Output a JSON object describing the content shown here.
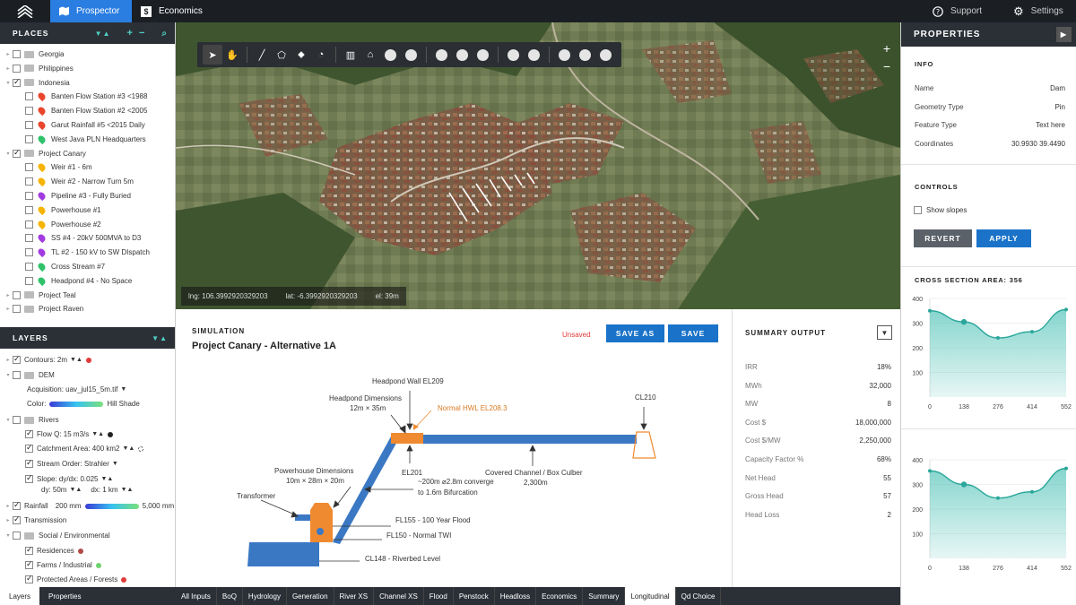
{
  "topbar": {
    "tabs": [
      {
        "label": "Prospector",
        "icon": "map-icon"
      },
      {
        "label": "Economics",
        "icon": "dollar-icon"
      }
    ],
    "support": "Support",
    "settings": "Settings"
  },
  "places": {
    "title": "PLACES",
    "items": [
      {
        "label": "Georgia",
        "kind": "folder",
        "checked": false
      },
      {
        "label": "Philippines",
        "kind": "folder",
        "checked": false
      },
      {
        "label": "Indonesia",
        "kind": "folder",
        "checked": true,
        "expanded": true
      },
      {
        "label": "Banten Flow Station #3 <1988",
        "kind": "pin",
        "color": "#e8452c"
      },
      {
        "label": "Banten Flow Station #2 <2005",
        "kind": "pin",
        "color": "#e8452c"
      },
      {
        "label": "Garut Rainfall #5 <2015 Daily",
        "kind": "pin",
        "color": "#e8452c"
      },
      {
        "label": "West Java PLN Headquarters",
        "kind": "pin",
        "color": "#2fc26b"
      },
      {
        "label": "Project Canary",
        "kind": "folder",
        "checked": true,
        "expanded": true
      },
      {
        "label": "Weir #1 - 6m",
        "kind": "pin",
        "color": "#f5b400"
      },
      {
        "label": "Weir #2 - Narrow Turn 5m",
        "kind": "pin",
        "color": "#f5b400"
      },
      {
        "label": "Pipeline #3 - Fully Buried",
        "kind": "pin",
        "color": "#a23be0"
      },
      {
        "label": "Powerhouse #1",
        "kind": "pin",
        "color": "#f5b400"
      },
      {
        "label": "Powerhouse #2",
        "kind": "pin",
        "color": "#f5b400"
      },
      {
        "label": "SS #4 - 20kV 500MVA to D3",
        "kind": "pin",
        "color": "#a23be0"
      },
      {
        "label": "TL #2 - 150 kV to SW DIspatch",
        "kind": "pin",
        "color": "#a23be0"
      },
      {
        "label": "Cross Stream #7",
        "kind": "pin",
        "color": "#2fc26b"
      },
      {
        "label": "Headpond #4 - No Space",
        "kind": "pin",
        "color": "#2fc26b"
      },
      {
        "label": "Project Teal",
        "kind": "folder",
        "checked": false
      },
      {
        "label": "Project Raven",
        "kind": "folder",
        "checked": false
      }
    ]
  },
  "layers": {
    "title": "LAYERS",
    "contours": "Contours: 2m",
    "dem": "DEM",
    "acquisition": "Acquisition: uav_jul15_5m.tif",
    "color_label": "Color:",
    "color_value": "Hill Shade",
    "rivers": "Rivers",
    "flow": "Flow Q: 15 m3/s",
    "catchment": "Catchment Area: 400 km2",
    "stream_order": "Stream Order: Strahler",
    "slope": "Slope: dy/dx: 0.025",
    "dy": "dy: 50m",
    "dx": "dx: 1 km",
    "rainfall": "Rainfall",
    "rain_min": "200 mm",
    "rain_max": "5,000 mm",
    "transmission": "Transmission",
    "social": "Social / Environmental",
    "residences": "Residences",
    "farms": "Farms / Industrial",
    "protected": "Protected Areas / Forests"
  },
  "left_tabs": [
    "Layers",
    "Properties"
  ],
  "map": {
    "lng": "lng: 106.3992920329203",
    "lat": "lat: -6.3992920329203",
    "el": "el: 39m",
    "zoom_in": "+",
    "zoom_out": "−"
  },
  "simulation": {
    "section": "SIMULATION",
    "title": "Project Canary - Alternative 1A",
    "status": "Unsaved",
    "save_as": "SAVE AS",
    "save": "SAVE",
    "labels": {
      "headpond_wall": "Headpond Wall EL209",
      "headpond_dims_1": "Headpond Dimensions",
      "headpond_dims_2": "12m × 35m",
      "normal_hwl": "Normal HWL EL208.3",
      "cl210": "CL210",
      "el201": "EL201",
      "converge_1": "~200m ⌀2.8m converge",
      "converge_2": "to 1.6m Bifurcation",
      "channel_1": "Covered Channel / Box Culber",
      "channel_2": "2,300m",
      "ph_dims_1": "Powerhouse Dimensions",
      "ph_dims_2": "10m × 28m × 20m",
      "transformer": "Transformer",
      "fl155": "FL155 - 100 Year Flood",
      "fl150": "FL150 - Normal TWI",
      "cl148": "CL148 - Riverbed Level"
    }
  },
  "summary": {
    "title": "SUMMARY OUTPUT",
    "rows": [
      {
        "k": "IRR",
        "v": "18%"
      },
      {
        "k": "MWh",
        "v": "32,000"
      },
      {
        "k": "MW",
        "v": "8"
      },
      {
        "k": "Cost $",
        "v": "18,000,000"
      },
      {
        "k": "Cost $/MW",
        "v": "2,250,000"
      },
      {
        "k": "Capacity Factor %",
        "v": "68%"
      },
      {
        "k": "Net Head",
        "v": "55"
      },
      {
        "k": "Gross Head",
        "v": "57"
      },
      {
        "k": "Head Loss",
        "v": "2"
      }
    ]
  },
  "bottom_tabs": [
    "All Inputs",
    "BoQ",
    "Hydrology",
    "Generation",
    "River XS",
    "Channel XS",
    "Flood",
    "Penstock",
    "Headloss",
    "Economics",
    "Summary",
    "Longitudinal",
    "Qd Choice"
  ],
  "properties": {
    "title": "PROPERTIES",
    "info_title": "INFO",
    "info": [
      {
        "k": "Name",
        "v": "Dam"
      },
      {
        "k": "Geometry Type",
        "v": "Pin"
      },
      {
        "k": "Feature Type",
        "v": "Text here"
      },
      {
        "k": "Coordinates",
        "v": "30.9930 39.4490"
      }
    ],
    "controls_title": "CONTROLS",
    "show_slopes": "Show slopes",
    "revert": "REVERT",
    "apply": "APPLY",
    "cross_section_title": "CROSS SECTION AREA: 356"
  },
  "colors": {
    "accent": "#2a7de1",
    "teal": "#2aa79b",
    "dark": "#2b3037"
  },
  "chart_data": [
    {
      "type": "area",
      "title": "CROSS SECTION AREA: 356",
      "x": [
        0,
        138,
        276,
        414,
        552
      ],
      "values": [
        350,
        305,
        240,
        265,
        355
      ],
      "xticks": [
        "0",
        "138",
        "276",
        "414",
        "552"
      ],
      "yticks": [
        "100",
        "200",
        "300",
        "400"
      ],
      "ylim": [
        0,
        400
      ]
    },
    {
      "type": "area",
      "x": [
        0,
        138,
        276,
        414,
        552
      ],
      "values": [
        355,
        300,
        245,
        270,
        365
      ],
      "xticks": [
        "0",
        "138",
        "276",
        "414",
        "552"
      ],
      "yticks": [
        "100",
        "200",
        "300",
        "400"
      ],
      "ylim": [
        0,
        400
      ]
    }
  ]
}
